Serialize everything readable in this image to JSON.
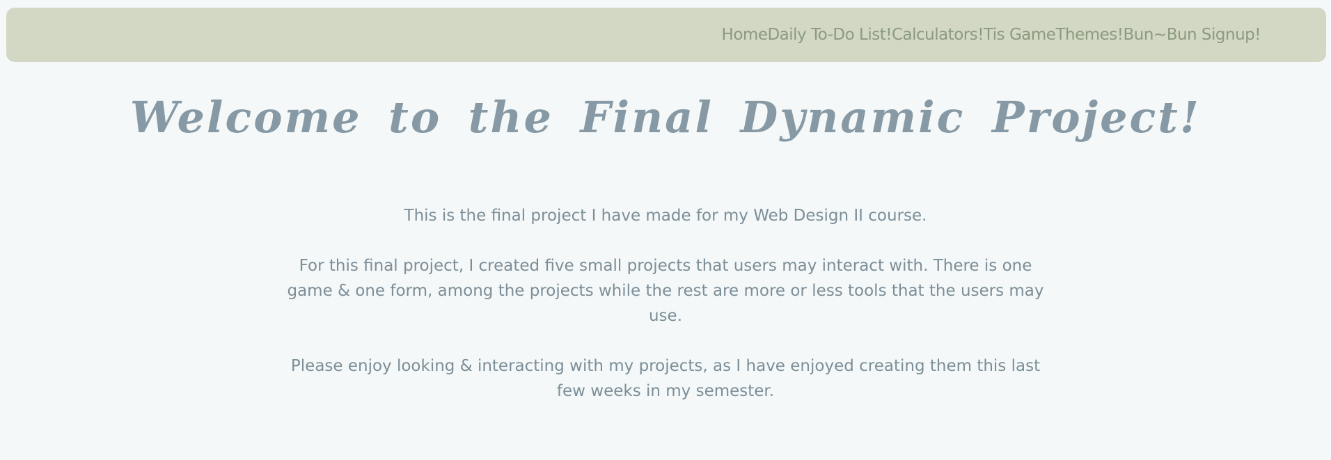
{
  "nav": {
    "items": [
      {
        "label": "Home"
      },
      {
        "label": "Daily To-Do List!"
      },
      {
        "label": "Calculators!"
      },
      {
        "label": "Tis Game"
      },
      {
        "label": "Themes!"
      },
      {
        "label": "Bun~Bun Signup!"
      }
    ]
  },
  "main": {
    "title": "Welcome to the Final Dynamic Project!",
    "paragraphs": [
      "This is the final project I have made for my Web Design II course.",
      "For this final project, I created five small projects that users may interact with. There is one game & one form, among the projects while the rest are more or less tools that the users may use.",
      "Please enjoy looking & interacting with my projects, as I have enjoyed creating them this last few weeks in my semester."
    ]
  },
  "colors": {
    "background": "#f4f8f8",
    "navbar": "#d3d8c4",
    "nav_text": "#8b9a80",
    "title": "#8699a4",
    "body_text": "#7c8e98"
  }
}
